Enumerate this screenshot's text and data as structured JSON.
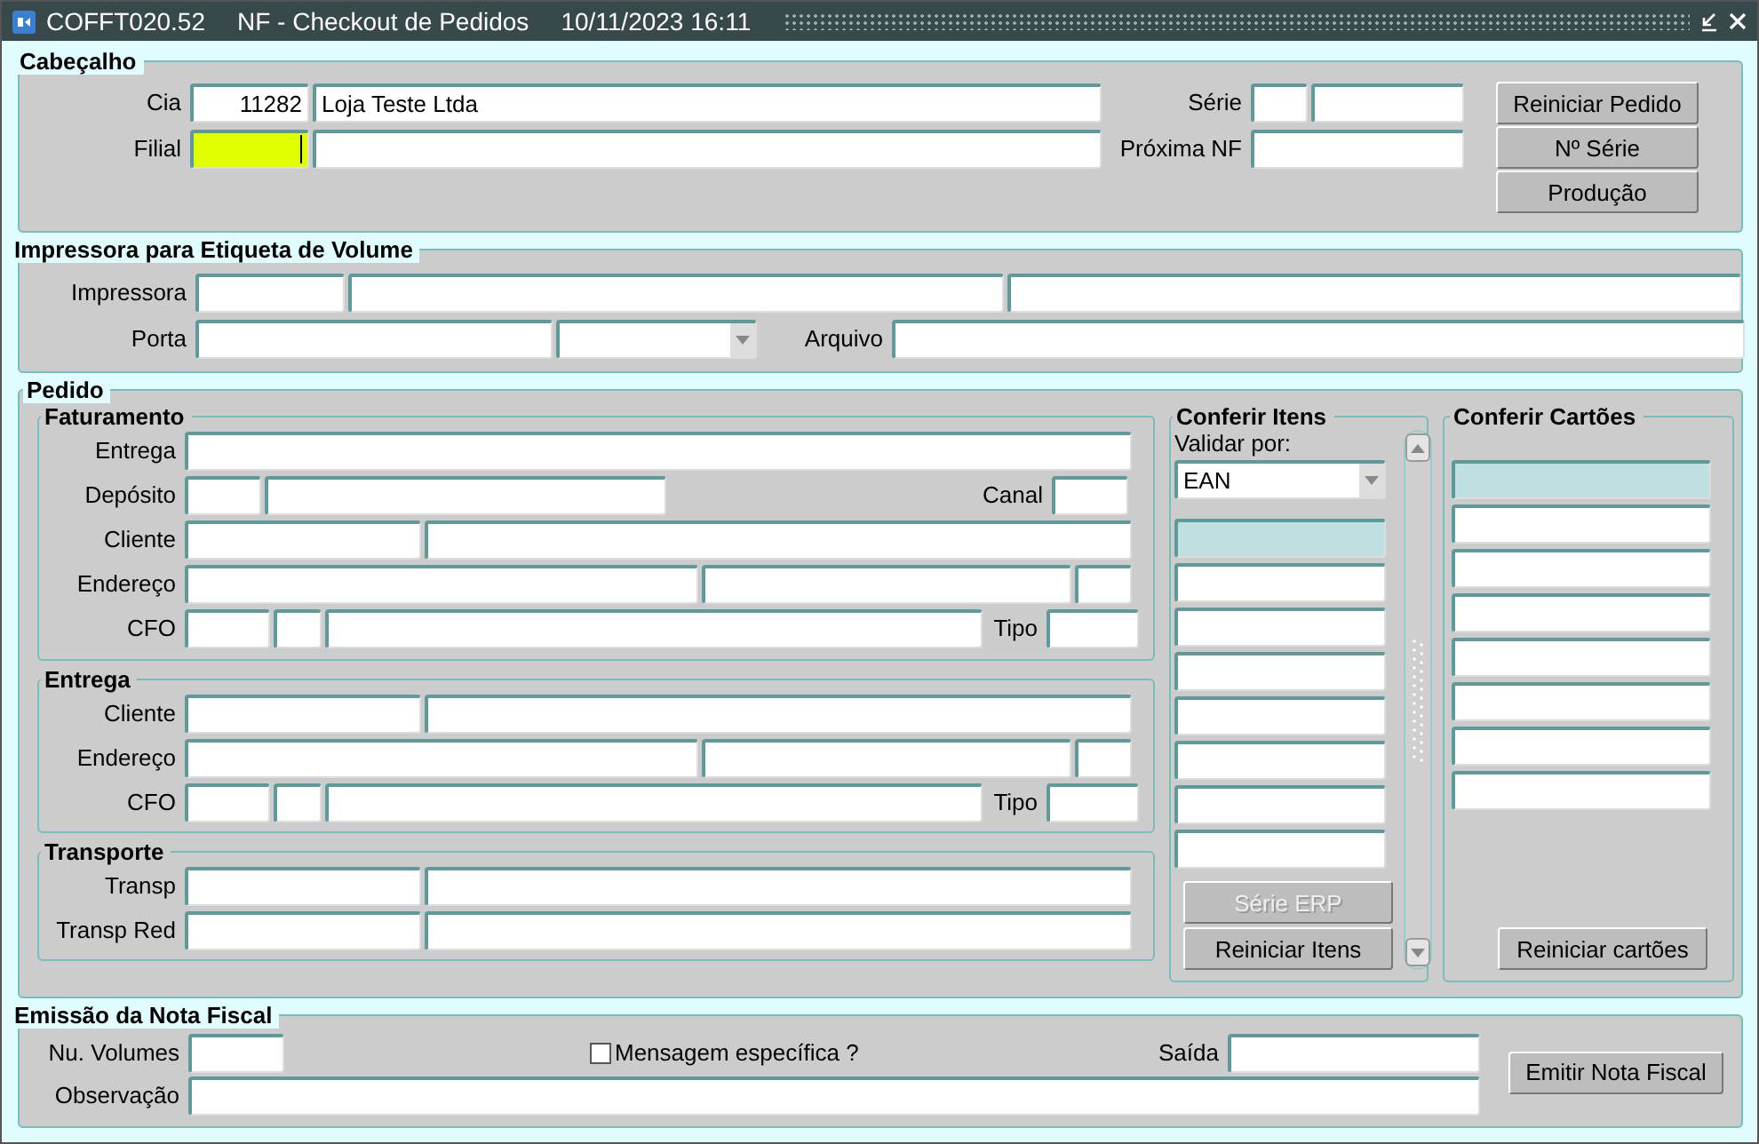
{
  "window": {
    "code": "COFFT020.52",
    "title": "NF - Checkout de Pedidos",
    "datetime": "10/11/2023 16:11"
  },
  "cabecalho": {
    "title": "Cabeçalho",
    "cia_label": "Cia",
    "cia_code": "11282",
    "cia_name": "Loja Teste Ltda",
    "filial_label": "Filial",
    "filial_focused": true,
    "serie_label": "Série",
    "proxima_label": "Próxima NF",
    "buttons": [
      "Reiniciar Pedido",
      "Nº Série",
      "Produção"
    ]
  },
  "impressora": {
    "title": "Impressora para Etiqueta de Volume",
    "impressora_label": "Impressora",
    "porta_label": "Porta",
    "arquivo_label": "Arquivo"
  },
  "pedido": {
    "title": "Pedido",
    "groups": [
      {
        "title": "Faturamento",
        "rows": [
          {
            "kind": "wide",
            "label": "Entrega"
          },
          {
            "kind": "deposit",
            "label": "Depósito",
            "extra_label": "Canal"
          },
          {
            "kind": "pair",
            "label": "Cliente"
          },
          {
            "kind": "address",
            "label": "Endereço"
          },
          {
            "kind": "cfo",
            "label": "CFO",
            "extra_label": "Tipo"
          }
        ]
      },
      {
        "title": "Entrega",
        "rows": [
          {
            "kind": "pair",
            "label": "Cliente"
          },
          {
            "kind": "address",
            "label": "Endereço"
          },
          {
            "kind": "cfo",
            "label": "CFO",
            "extra_label": "Tipo"
          }
        ]
      },
      {
        "title": "Transporte",
        "rows": [
          {
            "kind": "pair",
            "label": "Transp"
          },
          {
            "kind": "pair",
            "label": "Transp Red"
          }
        ]
      }
    ],
    "itens": {
      "title": "Conferir Itens",
      "validar_label": "Validar por:",
      "validar_value": "EAN",
      "rows": [
        {
          "selected": true
        },
        {
          "selected": false
        },
        {
          "selected": false
        },
        {
          "selected": false
        },
        {
          "selected": false
        },
        {
          "selected": false
        },
        {
          "selected": false
        },
        {
          "selected": false
        }
      ],
      "buttons": [
        {
          "label": "Série ERP",
          "disabled": true
        },
        {
          "label": "Reiniciar Itens",
          "disabled": false
        }
      ]
    },
    "cartoes": {
      "title": "Conferir Cartões",
      "rows": [
        {
          "selected": true
        },
        {
          "selected": false
        },
        {
          "selected": false
        },
        {
          "selected": false
        },
        {
          "selected": false
        },
        {
          "selected": false
        },
        {
          "selected": false
        },
        {
          "selected": false
        }
      ],
      "button": "Reiniciar cartões"
    }
  },
  "emissao": {
    "title": "Emissão da Nota Fiscal",
    "volumes_label": "Nu. Volumes",
    "mensagem": {
      "label": "Mensagem específica ?",
      "checked": false
    },
    "saida_label": "Saída",
    "observacao_label": "Observação",
    "button": "Emitir Nota Fiscal"
  }
}
